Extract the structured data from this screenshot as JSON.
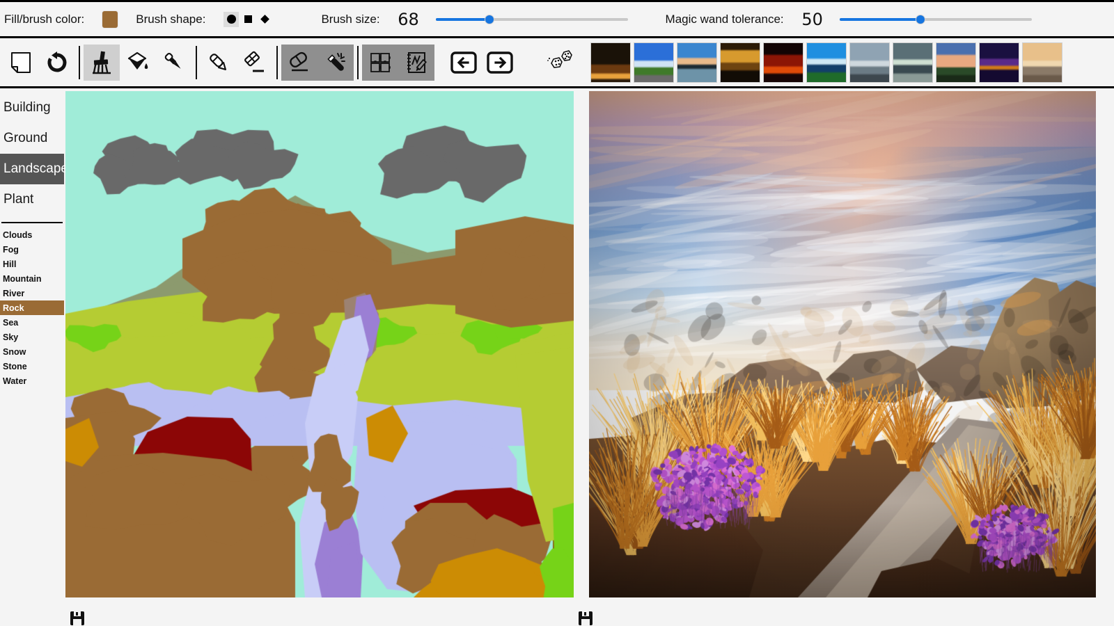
{
  "app": {
    "name": "semantic-image-synthesis-paint-tool"
  },
  "options_bar": {
    "fill_color_label": "Fill/brush color:",
    "fill_color_value": "#9a6b35",
    "brush_shape_label": "Brush shape:",
    "brush_shapes": [
      {
        "name": "circle",
        "glyph": "circle",
        "selected": true
      },
      {
        "name": "square",
        "glyph": "square",
        "selected": false
      },
      {
        "name": "diamond",
        "glyph": "diamond",
        "selected": false
      }
    ],
    "brush_size_label": "Brush size:",
    "brush_size_value": "68",
    "brush_size_percent": 28,
    "magic_wand_label": "Magic wand tolerance:",
    "magic_wand_value": "50",
    "magic_wand_percent": 42,
    "slider_accent": "#1675e0"
  },
  "tool_bar": {
    "tools": [
      {
        "name": "new-canvas-icon",
        "title": "New canvas",
        "state": "normal"
      },
      {
        "name": "rotate-icon",
        "title": "Reset / rotate",
        "state": "normal"
      },
      {
        "name": "brush-icon",
        "title": "Brush",
        "state": "active"
      },
      {
        "name": "paint-bucket-icon",
        "title": "Fill",
        "state": "normal"
      },
      {
        "name": "eyedropper-icon",
        "title": "Color picker",
        "state": "normal"
      },
      {
        "name": "pencil-icon",
        "title": "Pencil",
        "state": "normal"
      },
      {
        "name": "eraser-line-icon",
        "title": "Eraser stroke",
        "state": "normal"
      },
      {
        "name": "eraser-icon",
        "title": "Eraser",
        "state": "dark"
      },
      {
        "name": "magic-wand-icon",
        "title": "Magic wand",
        "state": "dark"
      },
      {
        "name": "puzzle-icon",
        "title": "Segment",
        "state": "dark"
      },
      {
        "name": "sketchpad-icon",
        "title": "Sketch",
        "state": "dark"
      },
      {
        "name": "arrow-left-icon",
        "title": "Undo / previous",
        "state": "normal"
      },
      {
        "name": "arrow-right-icon",
        "title": "Redo / next",
        "state": "normal"
      }
    ],
    "dice_icon": "dice-icon",
    "thumbnails": [
      {
        "name": "thumbnail-1",
        "label": "Sunset with trees"
      },
      {
        "name": "thumbnail-2",
        "label": "Road with clouds"
      },
      {
        "name": "thumbnail-3",
        "label": "Calm sea at dusk"
      },
      {
        "name": "thumbnail-4",
        "label": "Golden sunset over water"
      },
      {
        "name": "thumbnail-5",
        "label": "Deep red sunset"
      },
      {
        "name": "thumbnail-6",
        "label": "Blue bay and hills"
      },
      {
        "name": "thumbnail-7",
        "label": "Grey beach"
      },
      {
        "name": "thumbnail-8",
        "label": "Moonlit shore"
      },
      {
        "name": "thumbnail-9",
        "label": "Pink clouds over lake"
      },
      {
        "name": "thumbnail-10",
        "label": "Purple night reflection"
      },
      {
        "name": "thumbnail-11",
        "label": "Low tide sunset"
      }
    ]
  },
  "sidebar": {
    "categories": [
      {
        "label": "Building",
        "selected": false
      },
      {
        "label": "Ground",
        "selected": false
      },
      {
        "label": "Landscape",
        "selected": true
      },
      {
        "label": "Plant",
        "selected": false
      }
    ],
    "labels": [
      {
        "label": "Clouds",
        "selected": false,
        "color": "#696969"
      },
      {
        "label": "Fog",
        "selected": false,
        "color": "#b0b0b0"
      },
      {
        "label": "Hill",
        "selected": false,
        "color": "#8c9e6b"
      },
      {
        "label": "Mountain",
        "selected": false,
        "color": "#7f8f66"
      },
      {
        "label": "River",
        "selected": false,
        "color": "#b4b8ef"
      },
      {
        "label": "Rock",
        "selected": true,
        "color": "#9a6b35"
      },
      {
        "label": "Sea",
        "selected": false,
        "color": "#c3c9f5"
      },
      {
        "label": "Sky",
        "selected": false,
        "color": "#a0ecd8"
      },
      {
        "label": "Snow",
        "selected": false,
        "color": "#ffffff"
      },
      {
        "label": "Stone",
        "selected": false,
        "color": "#9c7f6a"
      },
      {
        "label": "Water",
        "selected": false,
        "color": "#9b7fd4"
      }
    ],
    "selected_label_color": "#9a6b35",
    "selected_category_color": "#555555"
  },
  "canvas": {
    "name": "semantic-segmentation-canvas",
    "sky_color": "#a0ecd8",
    "palette": {
      "sky": "#a0ecd8",
      "clouds": "#696969",
      "mountain": "#8c9a6e",
      "rock": "#9a6b35",
      "grass": "#b5cc33",
      "bright_grass": "#76d318",
      "sea": "#b9bff2",
      "river": "#c8cdf7",
      "water": "#9b7fd4",
      "earth": "#8c0606",
      "sand": "#cc8c04",
      "stone": "#9c8272",
      "dirt": "#8a5a12"
    }
  },
  "photo": {
    "name": "reference-photo",
    "description": "Rocky coastal stream at sunset with purple wildflowers and golden grass"
  },
  "bottom": {
    "save_icons": [
      {
        "name": "save-segmentation-icon"
      },
      {
        "name": "save-photo-icon"
      }
    ]
  }
}
